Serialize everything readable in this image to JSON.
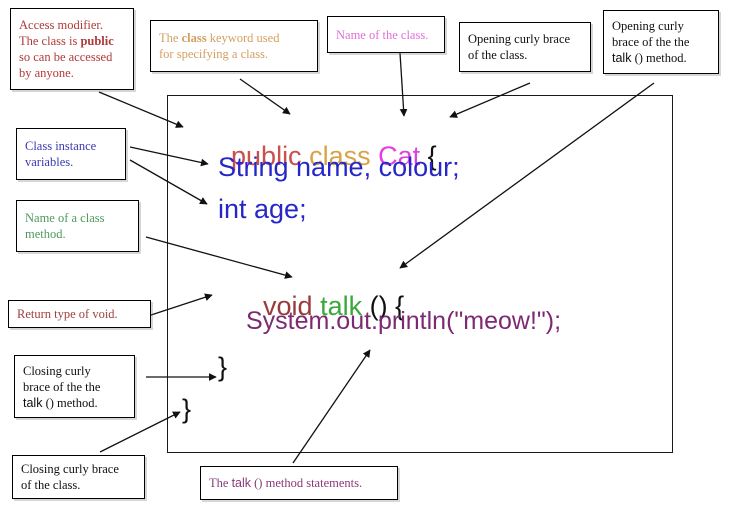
{
  "figure": {
    "kind": "annotated-java-class-diagram",
    "box_border_color": "#000000",
    "frame_border_color": "#1a1a1a",
    "background": "#ffffff"
  },
  "code": {
    "lines": [
      {
        "id": "class-declaration",
        "tokens": [
          {
            "text": "public",
            "color": "#c8504d"
          },
          {
            "text": " ",
            "color": "#101010"
          },
          {
            "text": "class",
            "color": "#d8a347"
          },
          {
            "text": " ",
            "color": "#101010"
          },
          {
            "text": "Cat",
            "color": "#e040e0"
          },
          {
            "text": " {",
            "color": "#101010"
          }
        ]
      },
      {
        "id": "field-string",
        "tokens": [
          {
            "text": "String name, colour;",
            "color": "#2727c8"
          }
        ]
      },
      {
        "id": "field-int",
        "tokens": [
          {
            "text": "int age;",
            "color": "#2727c8"
          }
        ]
      },
      {
        "id": "method-declaration",
        "tokens": [
          {
            "text": "void",
            "color": "#9a3b3b"
          },
          {
            "text": " ",
            "color": "#101010"
          },
          {
            "text": "talk",
            "color": "#3aa83a"
          },
          {
            "text": " () {",
            "color": "#101010"
          }
        ]
      },
      {
        "id": "method-body",
        "tokens": [
          {
            "text": "System.out.println(\"meow!\");",
            "color": "#7c2a72"
          }
        ]
      },
      {
        "id": "method-closing-brace",
        "tokens": [
          {
            "text": "}",
            "color": "#101010"
          }
        ]
      },
      {
        "id": "class-closing-brace",
        "tokens": [
          {
            "text": "}",
            "color": "#101010"
          }
        ]
      }
    ],
    "text_public": "public",
    "text_space1": " ",
    "text_class": "class",
    "text_space2": " ",
    "text_cat": "Cat",
    "text_open_brace_class": " {",
    "text_fields_string": "String name, colour;",
    "text_fields_int": "int age;",
    "text_void": "void",
    "text_space3": " ",
    "text_talk": "talk",
    "text_method_sig_tail": " () {",
    "text_println": "System.out.println(\"meow!\");",
    "text_close_method": "}",
    "text_close_class": "}"
  },
  "callouts": {
    "access_modifier": {
      "line1": "Access modifier.",
      "line2_pre": "The class is ",
      "line2_bold": "public",
      "line3": "so can be accessed",
      "line4": "by anyone.",
      "color": "#b03a3a"
    },
    "class_keyword": {
      "pre": "The ",
      "bold": "class",
      "post": " keyword used",
      "line2": "for specifying a class.",
      "color": "#d2a062"
    },
    "class_name": {
      "text": "Name of the class.",
      "color": "#e070d8"
    },
    "opening_brace_class": {
      "line1": "Opening curly brace",
      "line2": "of the class.",
      "color": "#101010"
    },
    "opening_brace_method": {
      "line1": "Opening curly",
      "line2": "brace of the the",
      "line3_pre": "talk",
      "line3_post": " () method.",
      "color": "#101010"
    },
    "instance_variables": {
      "line1": "Class instance",
      "line2": "variables.",
      "color": "#3a3ab0"
    },
    "method_name": {
      "line1": "Name of a class",
      "line2": "method.",
      "color": "#4e9a5e"
    },
    "return_type": {
      "text": "Return type of void.",
      "color": "#a04040"
    },
    "closing_brace_method": {
      "line1": "Closing curly",
      "line2": "brace of the the",
      "line3_pre": "talk",
      "line3_post": " () method.",
      "color": "#101010"
    },
    "closing_brace_class": {
      "line1": "Closing curly brace",
      "line2": "of the class.",
      "color": "#101010"
    },
    "method_statements": {
      "pre": "The ",
      "mid": "talk",
      "post": " () method statements.",
      "color": "#8a3a7a"
    }
  }
}
